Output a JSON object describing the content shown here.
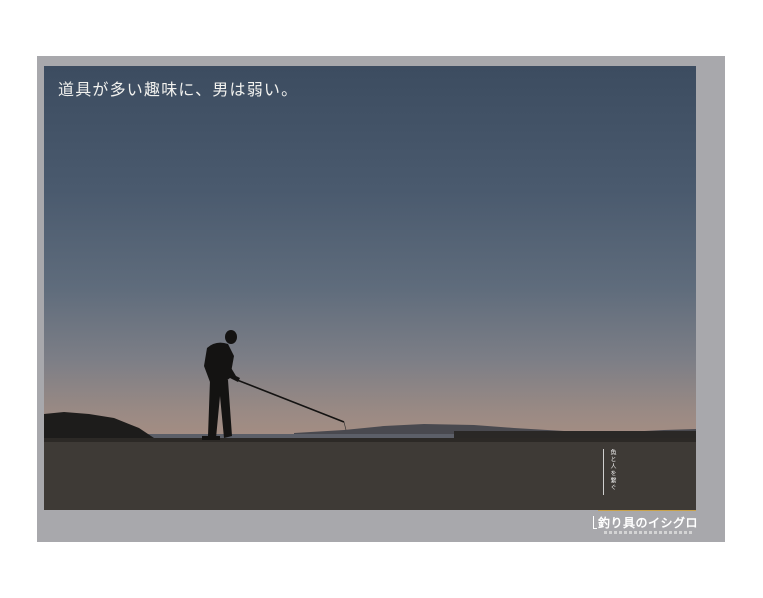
{
  "poster": {
    "headline": "道具が多い趣味に、男は弱い。",
    "tagline": "魚と人を繋ぐ",
    "brand": "釣り具のイシグロ"
  },
  "colors": {
    "frame": "#a8a8ac",
    "sky_top": "#3c4c60",
    "horizon_glow": "#a98f82",
    "silhouette": "#141312",
    "accent_rule": "#c9a24a"
  }
}
